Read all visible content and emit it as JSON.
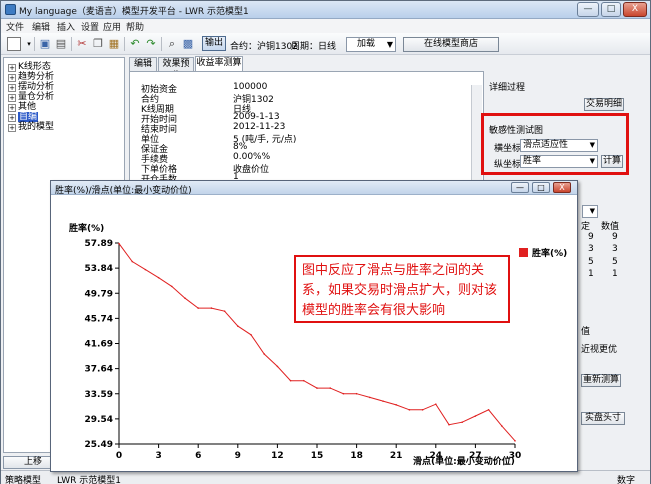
{
  "window": {
    "title": "My language（麦语言）模型开发平台 - LWR 示范模型1",
    "buttons": {
      "minimize": "—",
      "maximize": "□",
      "close": "X"
    }
  },
  "menu": [
    "文件",
    "编辑",
    "插入",
    "设置",
    "应用",
    "帮助"
  ],
  "toolbar": {
    "output_label": "输出",
    "contract": "合约：沪铜1302",
    "period": "周期：日线",
    "load_label": "加载",
    "online_store": "在线模型商店"
  },
  "tree": {
    "items": [
      {
        "label": "K线形态",
        "expand": "+"
      },
      {
        "label": "趋势分析",
        "expand": "+"
      },
      {
        "label": "摆动分析",
        "expand": "+"
      },
      {
        "label": "量仓分析",
        "expand": "+"
      },
      {
        "label": "其他",
        "expand": "+"
      },
      {
        "label": "自编",
        "expand": "+"
      },
      {
        "label": "我的模型",
        "expand": "+"
      }
    ]
  },
  "bottom": {
    "up_move": "上移"
  },
  "status": {
    "model_label": "策略模型",
    "model_name": "LWR 示范模型1",
    "mode": "数字"
  },
  "tabs": [
    "编辑",
    "效果预览",
    "收益率测算"
  ],
  "params": [
    {
      "k": "初始资金",
      "v": "100000"
    },
    {
      "k": "合约",
      "v": "沪铜1302"
    },
    {
      "k": "K线周期",
      "v": "日线"
    },
    {
      "k": "开始时间",
      "v": "2009-1-13"
    },
    {
      "k": "结束时间",
      "v": "2012-11-23"
    },
    {
      "k": "单位",
      "v": "5 (吨/手, 元/点)"
    },
    {
      "k": "保证金",
      "v": "8%"
    },
    {
      "k": "手续费",
      "v": "0.00%%"
    },
    {
      "k": "下单价格",
      "v": "收盘价位"
    },
    {
      "k": "开仓手数",
      "v": "1"
    }
  ],
  "right_panel": {
    "detail_process": "详细过程",
    "trade_detail": "交易明细",
    "sensitivity_test": "敏感性测试图",
    "x_axis_label": "横坐标",
    "x_axis_value": "滑点适应性",
    "y_axis_label": "纵坐标",
    "y_axis_value": "胜率",
    "calc_button": "计算",
    "col_fixed": "定",
    "col_value": "数值",
    "rows": [
      [
        "9",
        "9"
      ],
      [
        "3",
        "3"
      ],
      [
        "5",
        "5"
      ],
      [
        "1",
        "1"
      ]
    ],
    "partial_1": "值",
    "partial_2": "近视更优",
    "recalc": "重新测算",
    "realtime": "实盘头寸"
  },
  "chart_window": {
    "title": "胜率(%)/滑点(单位:最小变动价位)",
    "buttons": {
      "minimize": "—",
      "maximize": "□",
      "close": "X"
    }
  },
  "chart_data": {
    "type": "line",
    "ylabel": "胜率(%)",
    "xlabel": "滑点(单位:最小变动价位)",
    "legend": "胜率(%)",
    "legend_position": "top-right",
    "color": "#e02020",
    "ylim": [
      25.49,
      57.89
    ],
    "xlim": [
      0,
      30
    ],
    "yticks": [
      "57.89",
      "53.84",
      "49.79",
      "45.74",
      "41.69",
      "37.64",
      "33.59",
      "29.54",
      "25.49"
    ],
    "xticks": [
      "0",
      "3",
      "6",
      "9",
      "12",
      "15",
      "18",
      "21",
      "24",
      "27",
      "30"
    ],
    "grid": false,
    "x": [
      0,
      1,
      2,
      3,
      4,
      5,
      6,
      7,
      8,
      9,
      10,
      11,
      12,
      13,
      14,
      15,
      16,
      17,
      18,
      19,
      20,
      21,
      22,
      23,
      24,
      25,
      26,
      27,
      28,
      29,
      30
    ],
    "values": [
      57.8,
      54.9,
      53.6,
      52.3,
      50.9,
      49.0,
      47.4,
      47.4,
      46.9,
      44.5,
      43.1,
      40.0,
      38.0,
      35.7,
      35.7,
      34.5,
      34.5,
      33.6,
      33.6,
      33.0,
      32.4,
      31.8,
      31.0,
      31.0,
      31.9,
      28.6,
      29.0,
      30.0,
      31.0,
      28.4,
      26.0
    ]
  },
  "annotation": "图中反应了滑点与胜率之间的关系，如果交易时滑点扩大，则对该模型的胜率会有很大影响"
}
